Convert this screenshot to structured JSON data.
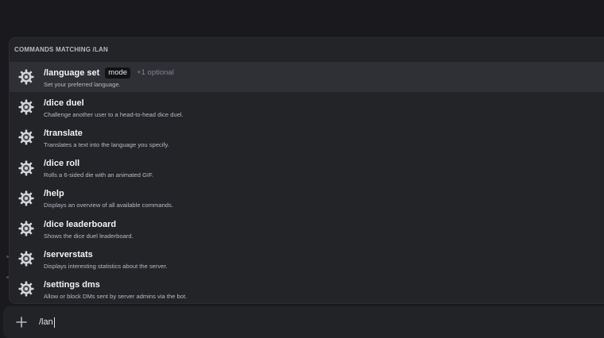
{
  "popup": {
    "header": "COMMANDS MATCHING /LAN",
    "commands": [
      {
        "name": "/language set",
        "option": "mode",
        "optional": "+1 optional",
        "description": "Set your preferred language.",
        "selected": true
      },
      {
        "name": "/dice duel",
        "description": "Challenge another user to a head-to-head dice duel."
      },
      {
        "name": "/translate",
        "description": "Translates a text into the language you specify."
      },
      {
        "name": "/dice roll",
        "description": "Rolls a 6-sided die with an animated GIF."
      },
      {
        "name": "/help",
        "description": "Displays an overview of all available commands."
      },
      {
        "name": "/dice leaderboard",
        "description": "Shows the dice duel leaderboard."
      },
      {
        "name": "/serverstats",
        "description": "Displays interesting statistics about the server."
      },
      {
        "name": "/settings dms",
        "description": "Allow or block DMs sent by server admins via the bot."
      }
    ]
  },
  "composer": {
    "value": "/lan",
    "add_icon": "plus-icon"
  },
  "colors": {
    "background": "#1a1a1e",
    "popup": "#232428",
    "selected_row": "#2e3035",
    "command_name": "#f2f3f5",
    "description": "#b5bac1"
  },
  "icons": {
    "command": "gear-icon"
  }
}
